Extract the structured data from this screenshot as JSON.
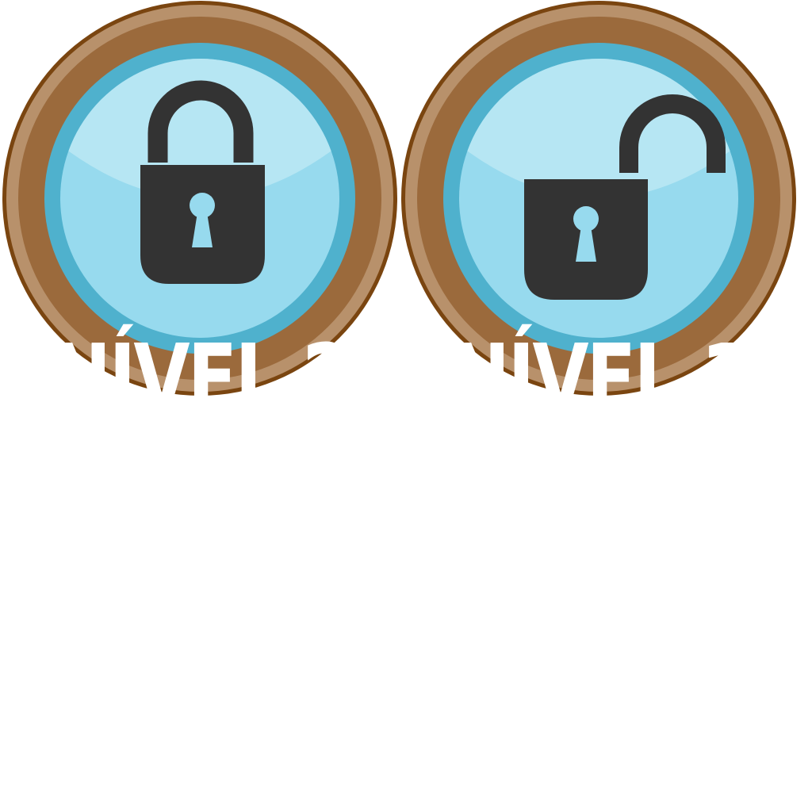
{
  "badges": [
    {
      "state": "locked",
      "icon": "locked-padlock-icon",
      "label": "NÍVEL 2"
    },
    {
      "state": "unlocked",
      "icon": "unlocked-padlock-icon",
      "label": "NÍVEL 1"
    }
  ],
  "colors": {
    "rim_dark": "#7a4510",
    "rim": "#9b6a3c",
    "rim_highlight": "#b8916b",
    "ring_blue": "#4fb1cd",
    "face_light": "#b6e6f3",
    "face": "#97daee",
    "padlock": "#333333",
    "keyhole": "#97daee",
    "label": "#ffffff",
    "background": "#ffffff"
  }
}
